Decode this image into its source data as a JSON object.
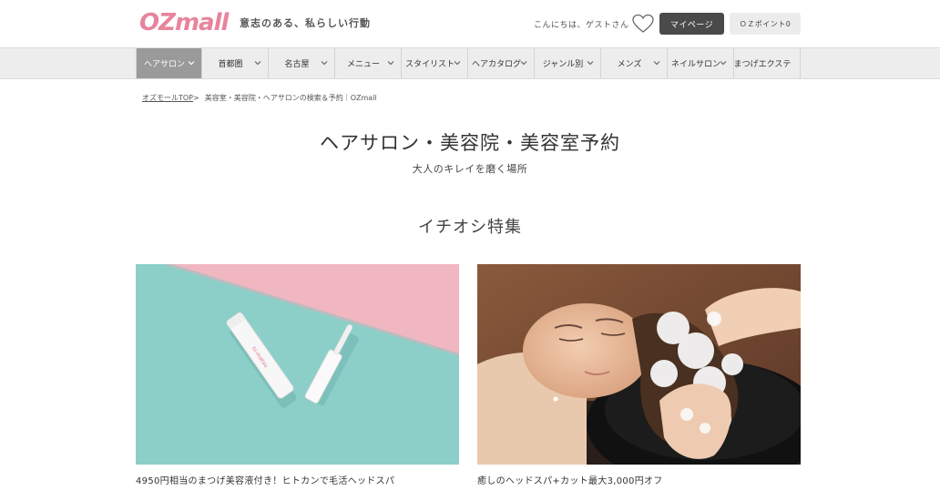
{
  "header": {
    "logo": "OZmall",
    "tagline": "意志のある、私らしい行動",
    "greeting": "こんにちは、ゲストさん",
    "mypage_label": "マイページ",
    "points_label": "ＯＺポイント0"
  },
  "nav": {
    "items": [
      {
        "label": "ヘアサロン",
        "active": true
      },
      {
        "label": "首都圏"
      },
      {
        "label": "名古屋"
      },
      {
        "label": "メニュー"
      },
      {
        "label": "スタイリスト"
      },
      {
        "label": "ヘアカタログ"
      },
      {
        "label": "ジャンル別"
      },
      {
        "label": "メンズ"
      },
      {
        "label": "ネイルサロン"
      },
      {
        "label": "まつげエクステ"
      }
    ]
  },
  "breadcrumb": {
    "home": "オズモールTOP",
    "separator": ">",
    "current": "美容室・美容院・ヘアサロンの検索＆予約｜OZmall"
  },
  "page": {
    "title": "ヘアサロン・美容院・美容室予約",
    "subtitle": "大人のキレイを磨く場所"
  },
  "featured": {
    "title": "イチオシ特集",
    "cards": [
      {
        "caption": "4950円相当のまつげ美容液付き！ヒトカンで毛活ヘッドスパ"
      },
      {
        "caption": "癒しのヘッドスパ+カット最大3,000円オフ"
      }
    ]
  },
  "colors": {
    "brand": "#e8849c",
    "nav_active": "#9a9a9a",
    "mypage_bg": "#4a4a4a"
  }
}
